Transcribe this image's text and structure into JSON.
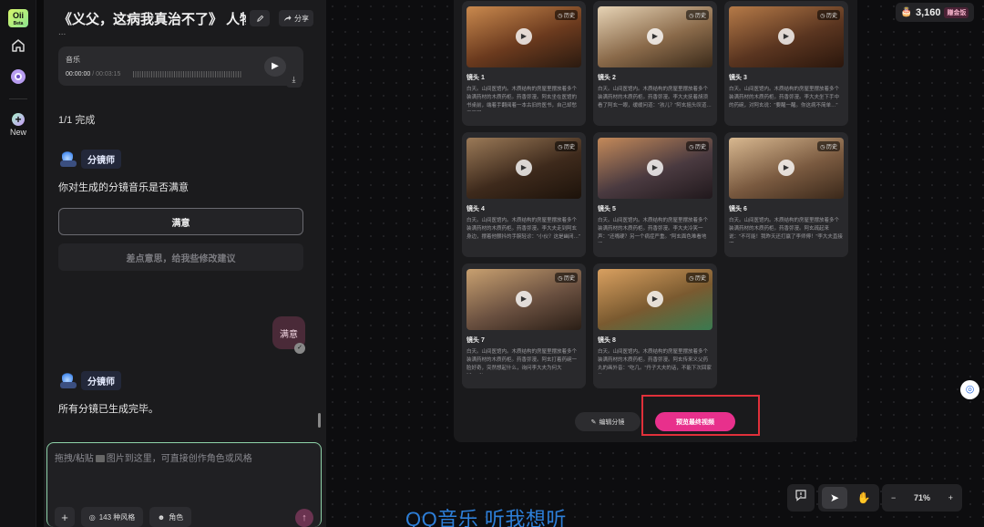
{
  "app": {
    "logo_text": "Oii",
    "logo_sub": "Beta",
    "new_label": "New"
  },
  "chat": {
    "title": "《义父，这病我真治不了》 人物设...",
    "share_label": "分享",
    "top_fragment": "...",
    "music": {
      "label": "音乐",
      "time_current": "00:00:00",
      "time_total": "/ 00:03:15"
    },
    "progress": "1/1 完成",
    "agent_name": "分镜师",
    "question": "你对生成的分镜音乐是否满意",
    "option_satisfied": "满意",
    "option_suggest": "差点意思，给我些修改建议",
    "user_reply": "满意",
    "done_message": "所有分镜已生成完毕。",
    "composer": {
      "placeholder_pre": "拖拽/粘贴",
      "placeholder_post": "图片到这里，可直接创作角色或风格",
      "styles_count": "143",
      "styles_label": "种风格",
      "role_label": "角色"
    }
  },
  "board": {
    "history_label": "历史",
    "shots": [
      {
        "title": "镜头 1",
        "desc": "白天。山间医馆内。木质结构的房屋里摆放着多个装满药材的木质药柜。药香弥漫。阿玄坐在医馆的书桌前，端着手翻阅着一本古旧的医书，自己却愁眉不展…"
      },
      {
        "title": "镜头 2",
        "desc": "白天。山间医馆内。木质结构的房屋里摆放着多个装满药材的木质药柜。药香弥漫。李大夫抚着胡须看了阿玄一眼，缓缓问道：\"孩儿？\"阿玄摇头叹道…"
      },
      {
        "title": "镜头 3",
        "desc": "白天。山间医馆内。木质结构的房屋里摆放着多个装满药材的木质药柜。药香弥漫。李大夫坐下手中的药碗，对阿玄说：\"要醒一醒。你这病不简单…\""
      },
      {
        "title": "镜头 4",
        "desc": "白天。山间医馆内。木质结构的房屋里摆放着多个装满药材的木质药柜。药香弥漫。李大夫走到阿玄身边，摆着他颤抖的手腕轻诊：\"小伙？这是幽闭…\""
      },
      {
        "title": "镜头 5",
        "desc": "白天。山间医馆内。木质结构的房屋里摆放着多个装满药材的木质药柜。药香弥漫。李大夫冷笑一声：\"还嘴硬？另一个病症严重。\"阿玄面色难看地问…"
      },
      {
        "title": "镜头 6",
        "desc": "白天。山间医馆内。木质结构的房屋里摆放着多个装满药材的木质药柜。药香弥漫。阿玄疏起来说：\"不可能！我昨天还打赢了李师傅！\"李大夫直接道…"
      },
      {
        "title": "镜头 7",
        "desc": "白天。山间医馆内。木质结构的房屋里摆放着多个装满药材的木质药柜。药香弥漫。阿玄打着药碗一脸好奇，突然想起什么，询问李大夫为何大喊：\"义…"
      },
      {
        "title": "镜头 8",
        "desc": "白天。山间医馆内。木质结构的房屋里摆放着多个装满药材的木质药柜。药香弥漫。阿玄传来义父药丸的画外音：\"吃几。\"丹子大夫的话，不能下次回家的…"
      }
    ],
    "edit_label": "编辑分镜",
    "preview_label": "预览最终视频"
  },
  "credits": {
    "amount": "3,160",
    "badge": "赚金饭"
  },
  "zoom": {
    "level": "71%",
    "minus": "−",
    "plus": "+"
  },
  "watermark": "QQ音乐 听我想听",
  "colors": {
    "accent_pink": "#e8308c",
    "highlight_red": "#e0303a",
    "composer_border": "#8fd3a9"
  }
}
